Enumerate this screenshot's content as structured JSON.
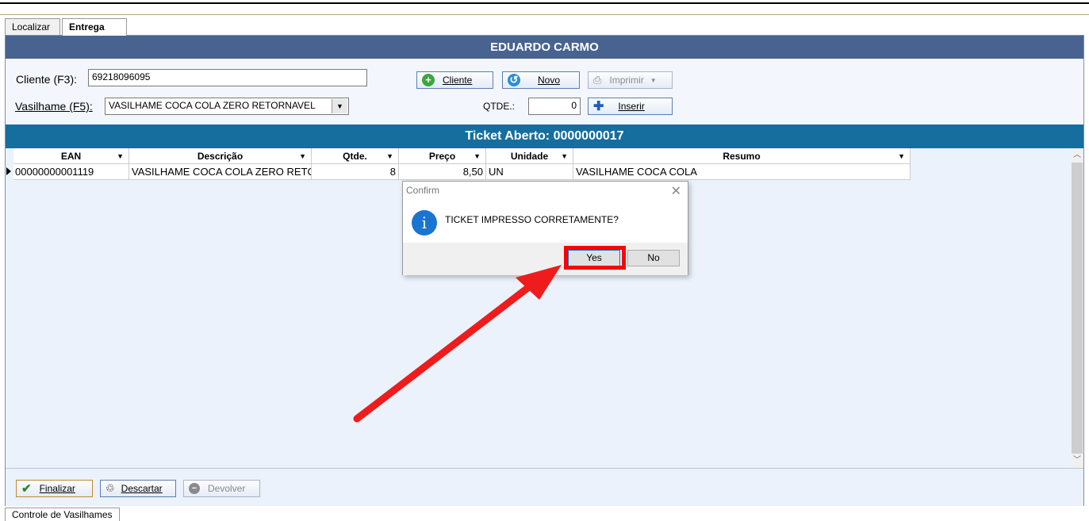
{
  "tabs": {
    "localizar": "Localizar",
    "entrega": "Entrega"
  },
  "header": {
    "client_name": "EDUARDO CARMO"
  },
  "form": {
    "cliente_label": "Cliente (F3):",
    "cliente_value": "69218096095",
    "vasilhame_label": "Vasilhame (F5):",
    "vasilhame_value": "VASILHAME COCA COLA ZERO RETORNAVEL",
    "qtde_label": "QTDE.:",
    "qtde_value": "0"
  },
  "buttons": {
    "cliente": "Cliente",
    "novo": "Novo",
    "imprimir": "Imprimir",
    "inserir": "Inserir",
    "finalizar": "Finalizar",
    "descartar": "Descartar",
    "devolver": "Devolver"
  },
  "ticket": {
    "title": "Ticket Aberto: 0000000017"
  },
  "table": {
    "columns": [
      "EAN",
      "Descrição",
      "Qtde.",
      "Preço",
      "Unidade",
      "Resumo"
    ],
    "rows": [
      {
        "ean": "00000000001119",
        "descricao": "VASILHAME COCA COLA ZERO RETC",
        "qtde": "8",
        "preco": "8,50",
        "unidade": "UN",
        "resumo": "VASILHAME COCA COLA"
      }
    ]
  },
  "dialog": {
    "title": "Confirm",
    "message": "TICKET IMPRESSO CORRETAMENTE?",
    "yes": "Yes",
    "no": "No"
  },
  "status_tab": "Controle de Vasilhames",
  "colors": {
    "header": "#48638f",
    "ticket_bar": "#166e9f",
    "highlight": "#ff0000",
    "info_icon": "#1a74d2"
  }
}
